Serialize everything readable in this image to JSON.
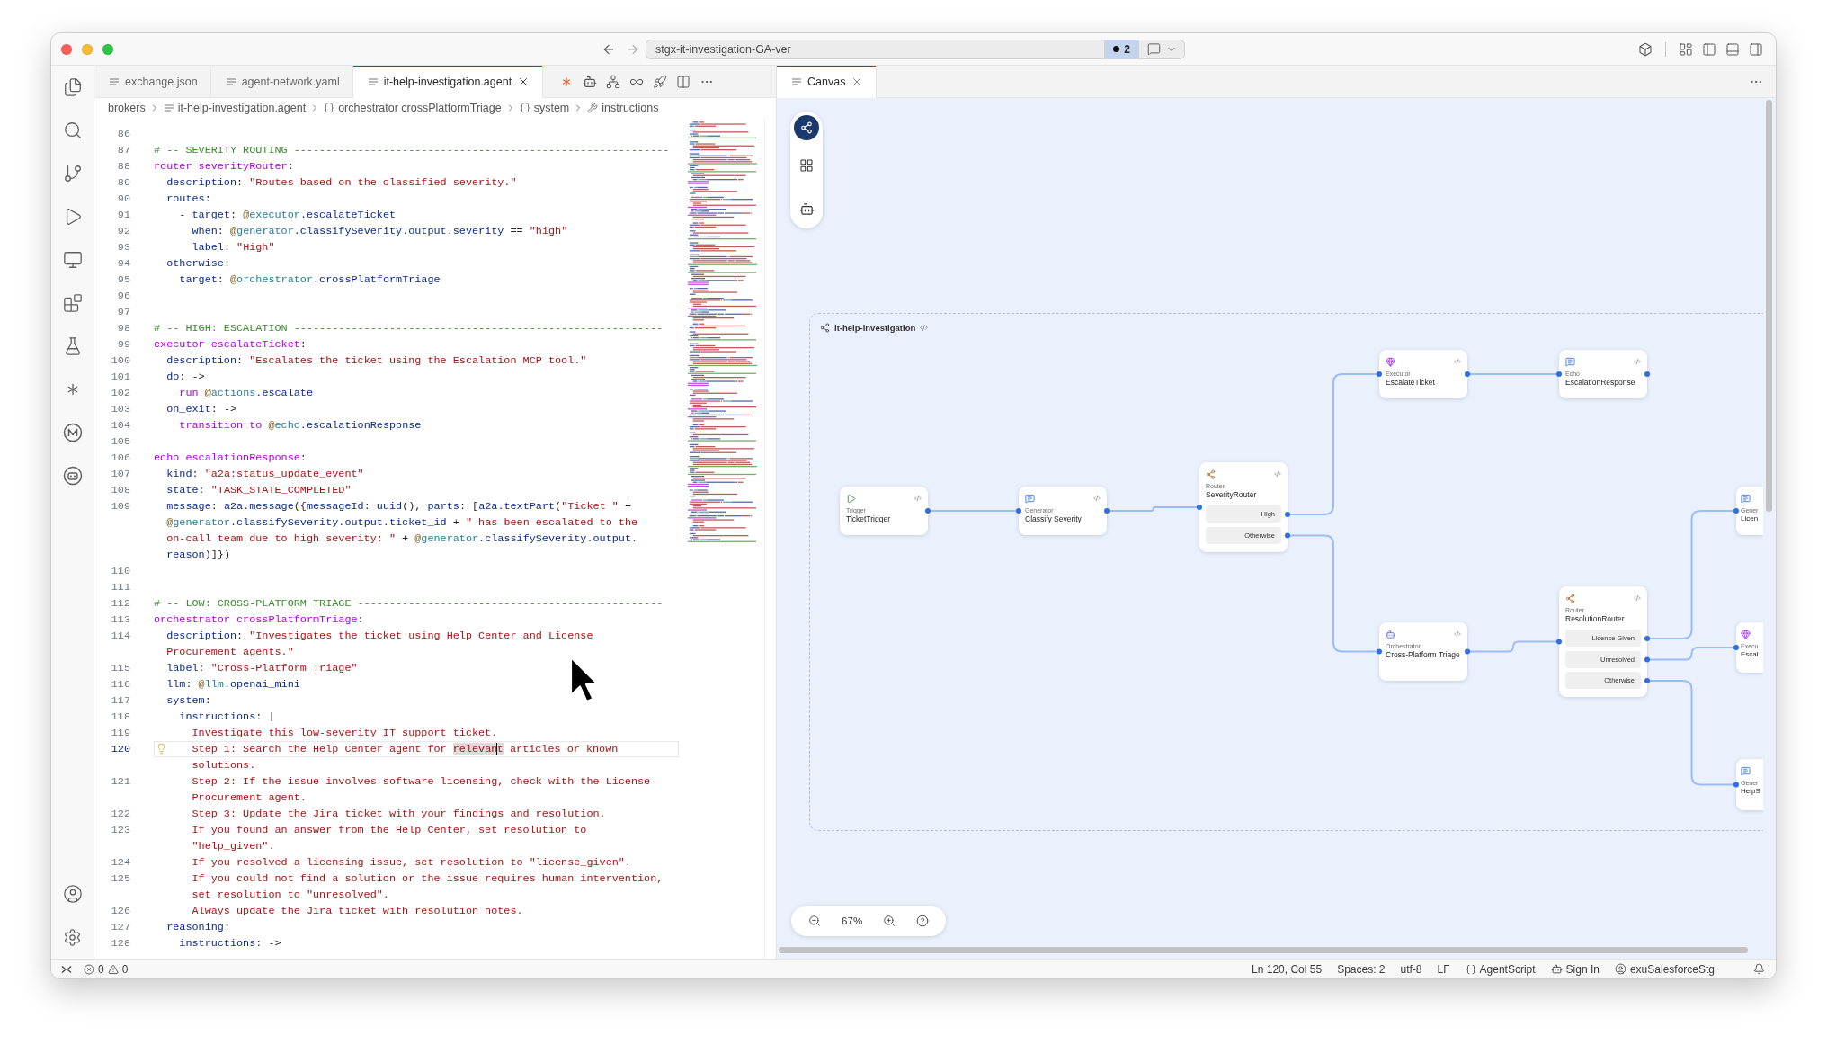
{
  "title_bar": {
    "command_center": "stgx-it-investigation-GA-ver",
    "badge": "2"
  },
  "editor_tabs": [
    {
      "label": "exchange.json",
      "selected": false
    },
    {
      "label": "agent-network.yaml",
      "selected": false
    },
    {
      "label": "it-help-investigation.agent",
      "selected": true
    }
  ],
  "breadcrumb": [
    {
      "kind": "folder",
      "label": "brokers"
    },
    {
      "kind": "file",
      "label": "it-help-investigation.agent"
    },
    {
      "kind": "object",
      "label": "orchestrator crossPlatformTriage"
    },
    {
      "kind": "object",
      "label": "system"
    },
    {
      "kind": "property",
      "label": "instructions"
    }
  ],
  "code_lines": [
    {
      "number": "86",
      "current": false
    },
    {
      "number": "87",
      "current": false,
      "rows": [
        {
          "tokens": [
            {
              "kind": "comment",
              "text": "# -- SEVERITY ROUTING -----------------------------------------------------------"
            }
          ]
        }
      ]
    },
    {
      "number": "88",
      "current": false,
      "rows": [
        {
          "tokens": [
            {
              "kind": "keyword",
              "text": "router severityRouter"
            },
            {
              "kind": "plain",
              "text": ":"
            }
          ]
        }
      ]
    },
    {
      "number": "89",
      "current": false,
      "rows": [
        {
          "tokens": [
            {
              "kind": "key",
              "text": "  description"
            },
            {
              "kind": "plain",
              "text": ": "
            },
            {
              "kind": "string",
              "text": "\"Routes based on the classified severity.\""
            }
          ]
        }
      ]
    },
    {
      "number": "90",
      "current": false,
      "rows": [
        {
          "tokens": [
            {
              "kind": "key",
              "text": "  routes"
            },
            {
              "kind": "plain",
              "text": ":"
            }
          ]
        }
      ]
    },
    {
      "number": "91",
      "current": false,
      "rows": [
        {
          "tokens": [
            {
              "kind": "plain",
              "text": "    - "
            },
            {
              "kind": "key",
              "text": "target"
            },
            {
              "kind": "plain",
              "text": ": "
            },
            {
              "kind": "at",
              "text": "@"
            },
            {
              "kind": "ref",
              "text": "executor"
            },
            {
              "kind": "key",
              "text": ".escalateTicket"
            }
          ]
        }
      ]
    },
    {
      "number": "92",
      "current": false,
      "rows": [
        {
          "tokens": [
            {
              "kind": "key",
              "text": "      when"
            },
            {
              "kind": "plain",
              "text": ": "
            },
            {
              "kind": "at",
              "text": "@"
            },
            {
              "kind": "ref",
              "text": "generator"
            },
            {
              "kind": "key",
              "text": ".classifySeverity.output.severity"
            },
            {
              "kind": "plain",
              "text": " == "
            },
            {
              "kind": "string",
              "text": "\"high\""
            }
          ]
        }
      ]
    },
    {
      "number": "93",
      "current": false,
      "rows": [
        {
          "tokens": [
            {
              "kind": "key",
              "text": "      label"
            },
            {
              "kind": "plain",
              "text": ": "
            },
            {
              "kind": "string",
              "text": "\"High\""
            }
          ]
        }
      ]
    },
    {
      "number": "94",
      "current": false,
      "rows": [
        {
          "tokens": [
            {
              "kind": "key",
              "text": "  otherwise"
            },
            {
              "kind": "plain",
              "text": ":"
            }
          ]
        }
      ]
    },
    {
      "number": "95",
      "current": false,
      "rows": [
        {
          "tokens": [
            {
              "kind": "key",
              "text": "    target"
            },
            {
              "kind": "plain",
              "text": ": "
            },
            {
              "kind": "at",
              "text": "@"
            },
            {
              "kind": "ref",
              "text": "orchestrator"
            },
            {
              "kind": "key",
              "text": ".crossPlatformTriage"
            }
          ]
        }
      ]
    },
    {
      "number": "96",
      "current": false
    },
    {
      "number": "97",
      "current": false
    },
    {
      "number": "98",
      "current": false,
      "rows": [
        {
          "tokens": [
            {
              "kind": "comment",
              "text": "# -- HIGH: ESCALATION ----------------------------------------------------------"
            }
          ]
        }
      ]
    },
    {
      "number": "99",
      "current": false,
      "rows": [
        {
          "tokens": [
            {
              "kind": "keyword",
              "text": "executor escalateTicket"
            },
            {
              "kind": "plain",
              "text": ":"
            }
          ]
        }
      ]
    },
    {
      "number": "100",
      "current": false,
      "rows": [
        {
          "tokens": [
            {
              "kind": "key",
              "text": "  description"
            },
            {
              "kind": "plain",
              "text": ": "
            },
            {
              "kind": "string",
              "text": "\"Escalates the ticket using the Escalation MCP tool.\""
            }
          ]
        }
      ]
    },
    {
      "number": "101",
      "current": false,
      "rows": [
        {
          "tokens": [
            {
              "kind": "key",
              "text": "  do"
            },
            {
              "kind": "plain",
              "text": ": ->"
            }
          ]
        }
      ]
    },
    {
      "number": "102",
      "current": false,
      "rows": [
        {
          "tokens": [
            {
              "kind": "keyword",
              "text": "    run "
            },
            {
              "kind": "at",
              "text": "@"
            },
            {
              "kind": "ref",
              "text": "actions"
            },
            {
              "kind": "key",
              "text": ".escalate"
            }
          ]
        }
      ]
    },
    {
      "number": "103",
      "current": false,
      "rows": [
        {
          "tokens": [
            {
              "kind": "key",
              "text": "  on_exit"
            },
            {
              "kind": "plain",
              "text": ": ->"
            }
          ]
        }
      ]
    },
    {
      "number": "104",
      "current": false,
      "rows": [
        {
          "tokens": [
            {
              "kind": "keyword",
              "text": "    transition to "
            },
            {
              "kind": "at",
              "text": "@"
            },
            {
              "kind": "ref",
              "text": "echo"
            },
            {
              "kind": "key",
              "text": ".escalationResponse"
            }
          ]
        }
      ]
    },
    {
      "number": "105",
      "current": false
    },
    {
      "number": "106",
      "current": false,
      "rows": [
        {
          "tokens": [
            {
              "kind": "keyword",
              "text": "echo escalationResponse"
            },
            {
              "kind": "plain",
              "text": ":"
            }
          ]
        }
      ]
    },
    {
      "number": "107",
      "current": false,
      "rows": [
        {
          "tokens": [
            {
              "kind": "key",
              "text": "  kind"
            },
            {
              "kind": "plain",
              "text": ": "
            },
            {
              "kind": "string",
              "text": "\"a2a:status_update_event\""
            }
          ]
        }
      ]
    },
    {
      "number": "108",
      "current": false,
      "rows": [
        {
          "tokens": [
            {
              "kind": "key",
              "text": "  state"
            },
            {
              "kind": "plain",
              "text": ": "
            },
            {
              "kind": "string",
              "text": "\"TASK_STATE_COMPLETED\""
            }
          ]
        }
      ]
    },
    {
      "number": "109",
      "current": false,
      "rows": [
        {
          "tokens": [
            {
              "kind": "key",
              "text": "  message"
            },
            {
              "kind": "plain",
              "text": ": "
            },
            {
              "kind": "key",
              "text": "a2a.message"
            },
            {
              "kind": "plain",
              "text": "({"
            },
            {
              "kind": "key",
              "text": "messageId"
            },
            {
              "kind": "plain",
              "text": ": "
            },
            {
              "kind": "key",
              "text": "uuid"
            },
            {
              "kind": "plain",
              "text": "(), "
            },
            {
              "kind": "key",
              "text": "parts"
            },
            {
              "kind": "plain",
              "text": ": ["
            },
            {
              "kind": "key",
              "text": "a2a.textPart"
            },
            {
              "kind": "plain",
              "text": "("
            },
            {
              "kind": "string",
              "text": "\"Ticket \""
            },
            {
              "kind": "plain",
              "text": " +"
            }
          ]
        },
        {
          "tokens": [
            {
              "kind": "at",
              "text": "  @"
            },
            {
              "kind": "ref",
              "text": "generator"
            },
            {
              "kind": "key",
              "text": ".classifySeverity.output.ticket_id"
            },
            {
              "kind": "plain",
              "text": " + "
            },
            {
              "kind": "string",
              "text": "\" has been escalated to the"
            }
          ]
        },
        {
          "tokens": [
            {
              "kind": "string",
              "text": "  on-call team due to high severity: \""
            },
            {
              "kind": "plain",
              "text": " + "
            },
            {
              "kind": "at",
              "text": "@"
            },
            {
              "kind": "ref",
              "text": "generator"
            },
            {
              "kind": "key",
              "text": ".classifySeverity.output."
            }
          ]
        },
        {
          "tokens": [
            {
              "kind": "key",
              "text": "  reason"
            },
            {
              "kind": "plain",
              "text": ")]})"
            }
          ]
        }
      ]
    },
    {
      "number": "110",
      "current": false
    },
    {
      "number": "111",
      "current": false
    },
    {
      "number": "112",
      "current": false,
      "rows": [
        {
          "tokens": [
            {
              "kind": "comment",
              "text": "# -- LOW: CROSS-PLATFORM TRIAGE ------------------------------------------------"
            }
          ]
        }
      ]
    },
    {
      "number": "113",
      "current": false,
      "rows": [
        {
          "tokens": [
            {
              "kind": "keyword",
              "text": "orchestrator crossPlatformTriage"
            },
            {
              "kind": "plain",
              "text": ":"
            }
          ]
        }
      ]
    },
    {
      "number": "114",
      "current": false,
      "rows": [
        {
          "tokens": [
            {
              "kind": "key",
              "text": "  description"
            },
            {
              "kind": "plain",
              "text": ": "
            },
            {
              "kind": "string",
              "text": "\"Investigates the ticket using Help Center and License"
            }
          ]
        },
        {
          "tokens": [
            {
              "kind": "string",
              "text": "  Procurement agents.\""
            }
          ]
        }
      ]
    },
    {
      "number": "115",
      "current": false,
      "rows": [
        {
          "tokens": [
            {
              "kind": "key",
              "text": "  label"
            },
            {
              "kind": "plain",
              "text": ": "
            },
            {
              "kind": "string",
              "text": "\"Cross-Platform Triage\""
            }
          ]
        }
      ]
    },
    {
      "number": "116",
      "current": false,
      "rows": [
        {
          "tokens": [
            {
              "kind": "key",
              "text": "  llm"
            },
            {
              "kind": "plain",
              "text": ": "
            },
            {
              "kind": "at",
              "text": "@"
            },
            {
              "kind": "ref",
              "text": "llm"
            },
            {
              "kind": "key",
              "text": ".openai_mini"
            }
          ]
        }
      ]
    },
    {
      "number": "117",
      "current": false,
      "rows": [
        {
          "tokens": [
            {
              "kind": "key",
              "text": "  system"
            },
            {
              "kind": "plain",
              "text": ":"
            }
          ]
        }
      ]
    },
    {
      "number": "118",
      "current": false,
      "rows": [
        {
          "tokens": [
            {
              "kind": "key",
              "text": "    instructions"
            },
            {
              "kind": "plain",
              "text": ": |"
            }
          ]
        }
      ]
    },
    {
      "number": "119",
      "current": false,
      "rows": [
        {
          "tokens": [
            {
              "kind": "string",
              "text": "      Investigate this low-severity IT support ticket."
            }
          ]
        }
      ]
    },
    {
      "number": "120",
      "current": true,
      "rows": [
        {
          "tokens": [
            {
              "kind": "string",
              "text": "      Step 1: Search the Help Center agent for "
            },
            {
              "kind": "selected",
              "text": "relevan"
            },
            {
              "kind": "caret",
              "text": "t"
            },
            {
              "kind": "string",
              "text": " articles or known"
            }
          ]
        },
        {
          "tokens": [
            {
              "kind": "string",
              "text": "      solutions."
            }
          ]
        }
      ]
    },
    {
      "number": "121",
      "current": false,
      "rows": [
        {
          "tokens": [
            {
              "kind": "string",
              "text": "      Step 2: If the issue involves software licensing, check with the License"
            }
          ]
        },
        {
          "tokens": [
            {
              "kind": "string",
              "text": "      Procurement agent."
            }
          ]
        }
      ]
    },
    {
      "number": "122",
      "current": false,
      "rows": [
        {
          "tokens": [
            {
              "kind": "string",
              "text": "      Step 3: Update the Jira ticket with your findings and resolution."
            }
          ]
        }
      ]
    },
    {
      "number": "123",
      "current": false,
      "rows": [
        {
          "tokens": [
            {
              "kind": "string",
              "text": "      If you found an answer from the Help Center, set resolution to"
            }
          ]
        },
        {
          "tokens": [
            {
              "kind": "string",
              "text": "      \"help_given\"."
            }
          ]
        }
      ]
    },
    {
      "number": "124",
      "current": false,
      "rows": [
        {
          "tokens": [
            {
              "kind": "string",
              "text": "      If you resolved a licensing issue, set resolution to \"license_given\"."
            }
          ]
        }
      ]
    },
    {
      "number": "125",
      "current": false,
      "rows": [
        {
          "tokens": [
            {
              "kind": "string",
              "text": "      If you could not find a solution or the issue requires human intervention,"
            }
          ]
        },
        {
          "tokens": [
            {
              "kind": "string",
              "text": "      set resolution to \"unresolved\"."
            }
          ]
        }
      ]
    },
    {
      "number": "126",
      "current": false,
      "rows": [
        {
          "tokens": [
            {
              "kind": "string",
              "text": "      Always update the Jira ticket with resolution notes."
            }
          ]
        }
      ]
    },
    {
      "number": "127",
      "current": false,
      "rows": [
        {
          "tokens": [
            {
              "kind": "key",
              "text": "  reasoning"
            },
            {
              "kind": "plain",
              "text": ":"
            }
          ]
        }
      ]
    },
    {
      "number": "128",
      "current": false,
      "rows": [
        {
          "tokens": [
            {
              "kind": "key",
              "text": "    instructions"
            },
            {
              "kind": "plain",
              "text": ": ->"
            }
          ]
        }
      ]
    }
  ],
  "canvas_tabs": [
    {
      "label": "Canvas",
      "selected": true
    }
  ],
  "canvas": {
    "group_title": "it-help-investigation",
    "zoom": "67%",
    "nodes": [
      {
        "kind": "trigger",
        "type": "Trigger",
        "name": "TicketTrigger",
        "clipped": false
      },
      {
        "kind": "generator",
        "type": "Generator",
        "name": "Classify Severity",
        "clipped": false
      },
      {
        "kind": "router",
        "type": "Router",
        "name": "SeverityRouter",
        "routes": [
          "High",
          "Otherwise"
        ],
        "clipped": false
      },
      {
        "kind": "executor",
        "type": "Executor",
        "name": "EscalateTicket",
        "clipped": false
      },
      {
        "kind": "echo",
        "type": "Echo",
        "name": "EscalationResponse",
        "clipped": false
      },
      {
        "kind": "orchestrator",
        "type": "Orchestrator",
        "name": "Cross-Platform Triage",
        "clipped": false
      },
      {
        "kind": "router",
        "type": "Router",
        "name": "ResolutionRouter",
        "routes": [
          "License Given",
          "Unresolved",
          "Otherwise"
        ],
        "clipped": false
      },
      {
        "kind": "generator",
        "type": "Gener",
        "name": "Licen",
        "clipped": true
      },
      {
        "kind": "executor",
        "type": "Execu",
        "name": "Escal",
        "clipped": true
      },
      {
        "kind": "generator",
        "type": "Gener",
        "name": "HelpS",
        "clipped": true
      }
    ]
  },
  "status_bar": {
    "errors": "0",
    "warnings": "0",
    "position": "Ln 120, Col 55",
    "indentation": "Spaces: 2",
    "encoding": "utf-8",
    "eol": "LF",
    "language": "AgentScript",
    "sign_in": "Sign In",
    "account": "exuSalesforceStg"
  }
}
